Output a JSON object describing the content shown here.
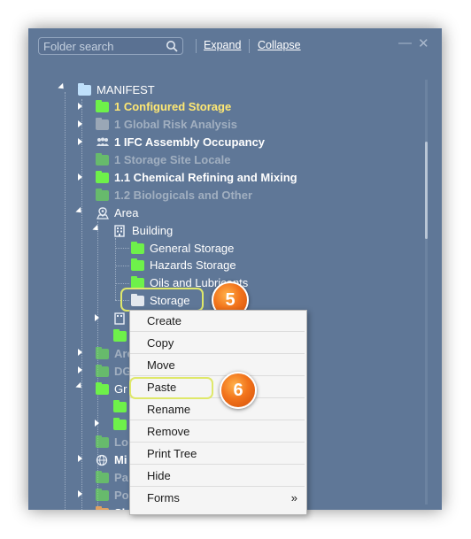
{
  "search": {
    "placeholder": "Folder search",
    "icon": "search-icon"
  },
  "toolbar": {
    "expand_label": "Expand",
    "collapse_label": "Collapse",
    "minimize_glyph": "—",
    "close_glyph": "✕"
  },
  "tree": {
    "root": "MANIFEST",
    "items": [
      {
        "label": "1 Configured Storage",
        "style": "yellow",
        "icon": "folder-green-icon"
      },
      {
        "label": "1 Global Risk Analysis",
        "style": "gray",
        "icon": "folder-gray-icon"
      },
      {
        "label": "1 IFC Assembly Occupancy",
        "style": "white",
        "icon": "people-icon"
      },
      {
        "label": "1 Storage Site Locale",
        "style": "gray",
        "icon": "folder-green-icon"
      },
      {
        "label": "1.1 Chemical Refining and Mixing",
        "style": "white",
        "icon": "folder-green-icon"
      },
      {
        "label": "1.2 Biologicals and Other",
        "style": "gray",
        "icon": "folder-green-icon"
      },
      {
        "label": "Area",
        "style": "white-normal",
        "icon": "map-pin-icon"
      },
      {
        "label": "Building",
        "style": "white-normal",
        "icon": "building-icon"
      },
      {
        "label": "General Storage",
        "style": "white-normal",
        "icon": "folder-green-icon"
      },
      {
        "label": "Hazards Storage",
        "style": "white-normal",
        "icon": "folder-green-icon"
      },
      {
        "label": "Oils and Lubricants",
        "style": "white-normal",
        "icon": "folder-green-icon"
      },
      {
        "label": "Storage",
        "style": "white-normal",
        "icon": "folder-light-icon"
      }
    ],
    "truncated": [
      "Are",
      "DG",
      "Gr",
      "Lo",
      "Mi",
      "Pa",
      "Po",
      "Sh"
    ]
  },
  "context_menu": {
    "items": [
      "Create",
      "Copy",
      "Move",
      "Paste",
      "Rename",
      "Remove",
      "Print Tree",
      "Hide",
      "Forms"
    ],
    "submenu_arrow": "»"
  },
  "badges": {
    "step_a": "5",
    "step_b": "6"
  },
  "colors": {
    "panel": "#5f7797",
    "highlight": "#dfe86a",
    "badge": "#f2741c",
    "folder_green": "#6ef14a"
  }
}
